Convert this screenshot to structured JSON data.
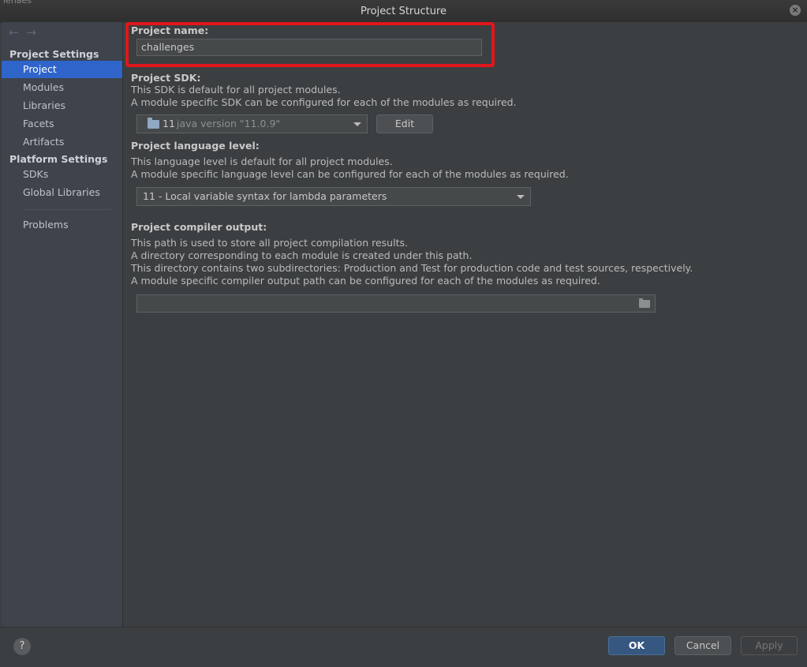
{
  "window": {
    "title": "Project Structure",
    "background_fragment": "ienaes",
    "close_glyph": "×"
  },
  "sidebar": {
    "nav_back": "←",
    "nav_forward": "→",
    "project_settings_header": "Project Settings",
    "project_items": [
      "Project",
      "Modules",
      "Libraries",
      "Facets",
      "Artifacts"
    ],
    "platform_settings_header": "Platform Settings",
    "platform_items": [
      "SDKs",
      "Global Libraries"
    ],
    "problems": "Problems",
    "selected": "Project"
  },
  "project_name": {
    "label": "Project name:",
    "value": "challenges"
  },
  "project_sdk": {
    "label": "Project SDK:",
    "desc_1": "This SDK is default for all project modules.",
    "desc_2": "A module specific SDK can be configured for each of the modules as required.",
    "selected_number": "11",
    "selected_version": "java version \"11.0.9\"",
    "edit_button": "Edit"
  },
  "language_level": {
    "label": "Project language level:",
    "desc_1": "This language level is default for all project modules.",
    "desc_2": "A module specific language level can be configured for each of the modules as required.",
    "selected": "11 - Local variable syntax for lambda parameters"
  },
  "compiler_output": {
    "label": "Project compiler output:",
    "desc_1": "This path is used to store all project compilation results.",
    "desc_2": "A directory corresponding to each module is created under this path.",
    "desc_3": "This directory contains two subdirectories: Production and Test for production code and test sources, respectively.",
    "desc_4": "A module specific compiler output path can be configured for each of the modules as required.",
    "path_value": ""
  },
  "footer": {
    "help": "?",
    "ok": "OK",
    "cancel": "Cancel",
    "apply": "Apply"
  },
  "colors": {
    "selection": "#2f65ca",
    "highlight_border": "#e0161c",
    "ok_button": "#365880"
  }
}
